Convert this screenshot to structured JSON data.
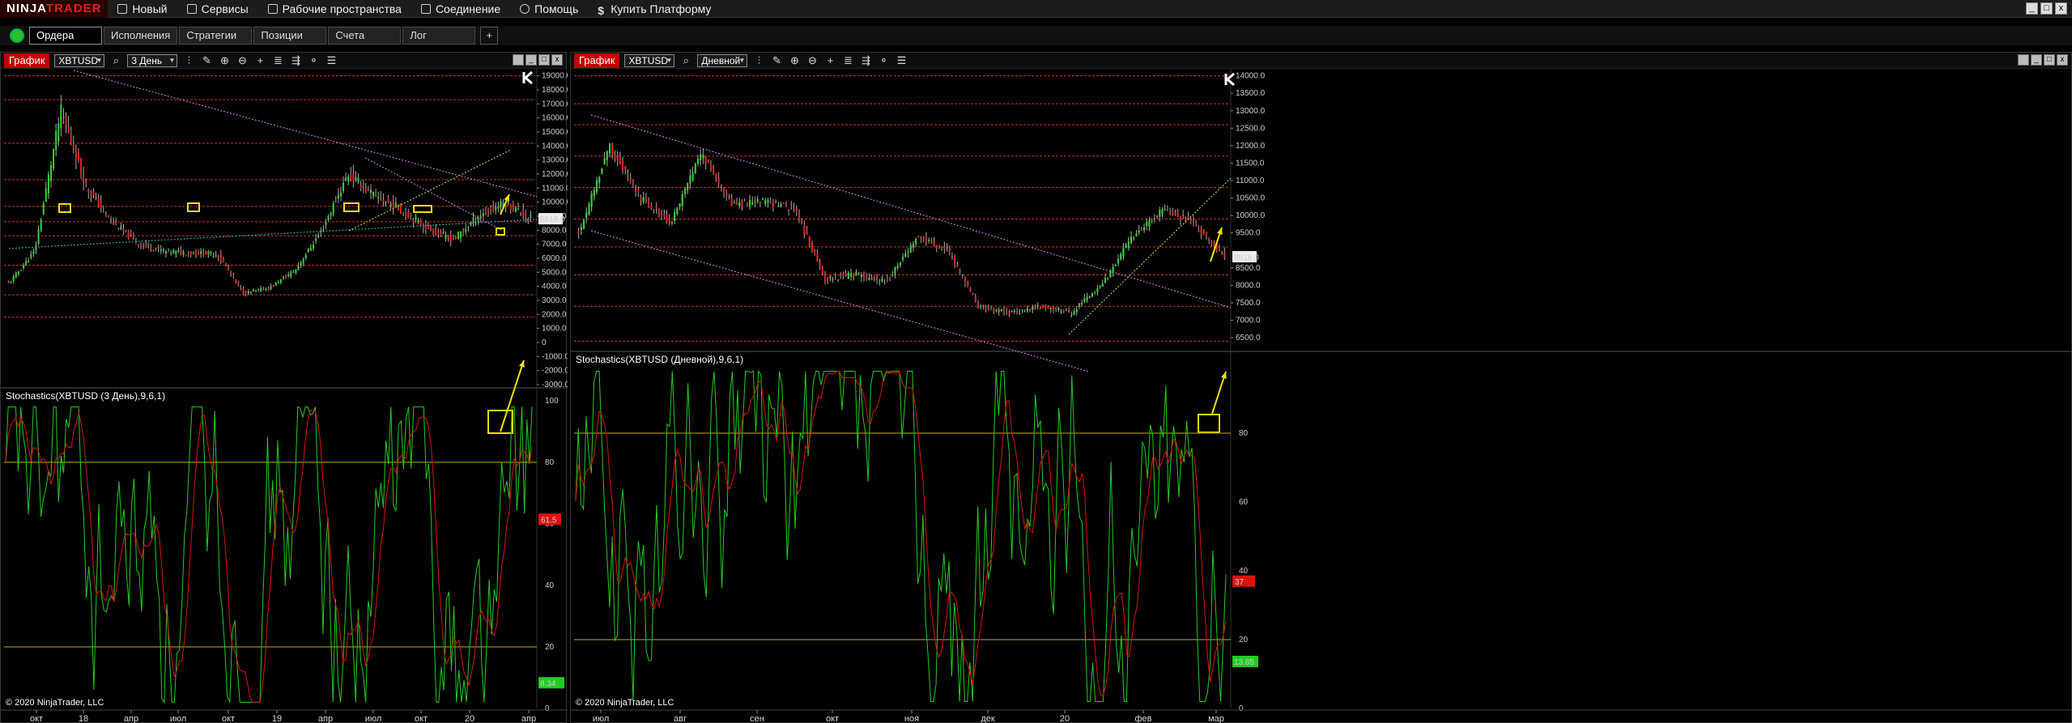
{
  "app": {
    "logo_left": "NINJA",
    "logo_right": "TRADER",
    "menu": [
      {
        "label": "Новый",
        "icon": "new-document-icon"
      },
      {
        "label": "Сервисы",
        "icon": "tools-icon"
      },
      {
        "label": "Рабочие пространства",
        "icon": "workspace-icon"
      },
      {
        "label": "Соединение",
        "icon": "connection-plug-icon"
      },
      {
        "label": "Помощь",
        "icon": "help-lifebuoy-icon"
      },
      {
        "label": "Купить Платформу",
        "icon": "dollar-icon"
      }
    ],
    "window_controls": [
      "_",
      "□",
      "x"
    ]
  },
  "tabs": {
    "items": [
      "Ордера",
      "Исполнения",
      "Стратегии",
      "Позиции",
      "Счета",
      "Лог"
    ],
    "active": 0,
    "add_label": "+"
  },
  "colors": {
    "up": "#33cc33",
    "down": "#e02020",
    "hline": "#d03030",
    "trend": "#c070d0",
    "channel": "#9acd32",
    "teal": "#2aa6a6",
    "highlight": "#f0e000",
    "stoch_k": "#22cc22",
    "stoch_d": "#dd1111",
    "stoch_level": "#a08a00"
  },
  "charts": {
    "left": {
      "title": "График",
      "instrument": "XBTUSD",
      "period": "3 День",
      "indicator": "Stochastics(XBTUSD (3 День),9,6,1)",
      "copyright": "© 2020 NinjaTrader, LLC",
      "price_marker": "8818.0",
      "stoch_k_marker": "61.5",
      "stoch_d_marker": "8.34",
      "corner_label": "F",
      "y_ticks": [
        "19000.0",
        "18000.0",
        "17000.0",
        "16000.0",
        "15000.0",
        "14000.0",
        "13000.0",
        "12000.0",
        "11000.0",
        "10000.0",
        "9000.0",
        "8000.0",
        "7000.0",
        "6000.0",
        "5000.0",
        "4000.0",
        "3000.0",
        "2000.0",
        "1000.0",
        "0",
        "-1000.0",
        "-2000.0",
        "-3000.0"
      ],
      "stoch_ticks": [
        "100",
        "80",
        "60",
        "40",
        "20",
        "0"
      ],
      "x_ticks": [
        "окт",
        "18",
        "апр",
        "июл",
        "окт",
        "19",
        "апр",
        "июл",
        "окт",
        "20",
        "апр"
      ]
    },
    "right": {
      "title": "График",
      "instrument": "XBTUSD",
      "period": "Дневной",
      "indicator": "Stochastics(XBTUSD (Дневной),9,6,1)",
      "copyright": "© 2020 NinjaTrader, LLC",
      "price_marker": "8818.0",
      "price_marker2": "9000.0",
      "stoch_k_marker": "37",
      "stoch_d_marker": "13.65",
      "y_ticks": [
        "14000.0",
        "13500.0",
        "13000.0",
        "12500.0",
        "12000.0",
        "11500.0",
        "11000.0",
        "10500.0",
        "10000.0",
        "9500.0",
        "8500.0",
        "8000.0",
        "7500.0",
        "7000.0",
        "6500.0"
      ],
      "stoch_ticks": [
        "80",
        "60",
        "40",
        "20",
        "0"
      ],
      "x_ticks": [
        "июл",
        "авг",
        "сен",
        "окт",
        "ноя",
        "дек",
        "20",
        "фев",
        "мар"
      ]
    }
  },
  "chart_data": [
    {
      "type": "candlestick",
      "title": "XBTUSD (3 День)",
      "ylim": [
        -3000,
        19500
      ],
      "x_ticks": [
        "окт",
        "18",
        "апр",
        "июл",
        "окт",
        "19",
        "апр",
        "июл",
        "окт",
        "20",
        "апр"
      ],
      "approx_close_path": [
        4200,
        6500,
        16500,
        11000,
        8500,
        7000,
        6500,
        6400,
        6300,
        3500,
        3900,
        5200,
        8000,
        12000,
        10500,
        9500,
        8200,
        7300,
        9000,
        10000,
        8818
      ],
      "horizontal_levels": [
        19000,
        17300,
        14200,
        11600,
        9700,
        8600,
        7600,
        5500,
        3400,
        1800
      ],
      "stochastics": {
        "period": "9,6,1",
        "levels": [
          80,
          20
        ],
        "last_k": 61.5,
        "last_d": 8.34
      }
    },
    {
      "type": "candlestick",
      "title": "XBTUSD (Дневной)",
      "ylim": [
        6200,
        14200
      ],
      "x_ticks": [
        "июл",
        "авг",
        "сен",
        "окт",
        "ноя",
        "дек",
        "20",
        "фев",
        "мар"
      ],
      "approx_close_path": [
        9500,
        12000,
        10500,
        9800,
        11800,
        10300,
        10400,
        10200,
        8200,
        8300,
        8100,
        9400,
        9000,
        7400,
        7200,
        7400,
        7200,
        8000,
        9400,
        10200,
        9800,
        8818
      ],
      "horizontal_levels": [
        14000,
        13200,
        12600,
        11700,
        10800,
        9900,
        9100,
        8300,
        7400,
        6400
      ],
      "stochastics": {
        "period": "9,6,1",
        "levels": [
          80,
          20
        ],
        "last_k": 37,
        "last_d": 13.65
      }
    }
  ]
}
